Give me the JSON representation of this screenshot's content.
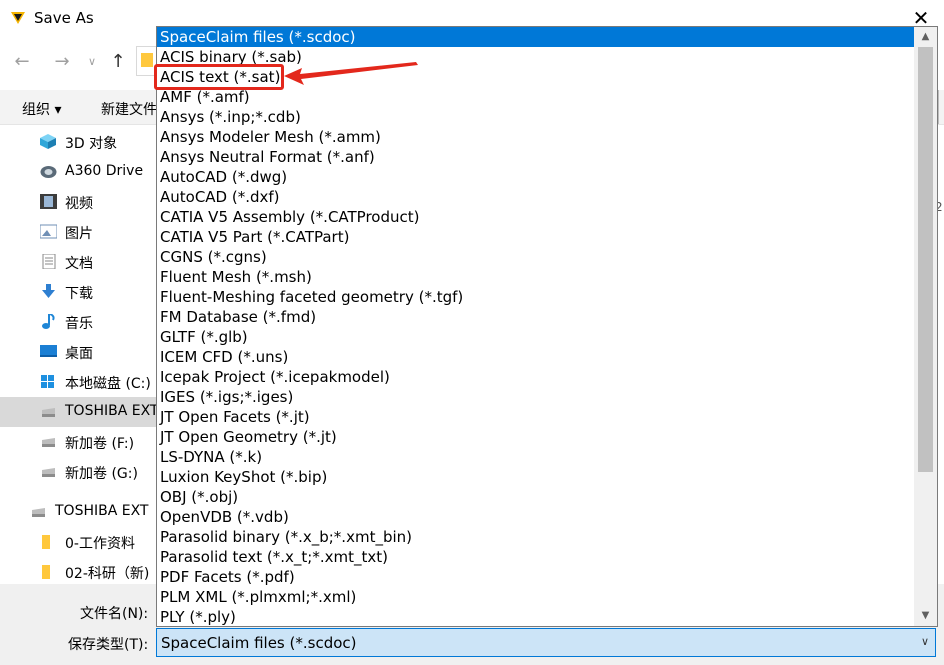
{
  "window": {
    "title": "Save As",
    "close_glyph": "✕",
    "app_icon": "spaceclaim-app-icon"
  },
  "nav": {
    "back_glyph": "←",
    "forward_glyph": "→",
    "recent_glyph": "∨",
    "up_glyph": "↑"
  },
  "toolbar": {
    "organize_label": "组织 ▾",
    "new_folder_label": "新建文件"
  },
  "sidebar": {
    "items": [
      {
        "label": "3D 对象",
        "icon": "3d-objects-icon",
        "color": "#30a7d9"
      },
      {
        "label": "A360 Drive",
        "icon": "a360-drive-icon",
        "color": "#5a6a78"
      },
      {
        "label": "视频",
        "icon": "video-icon",
        "color": "#3c3c3c"
      },
      {
        "label": "图片",
        "icon": "pictures-icon",
        "color": "#6f8fb5"
      },
      {
        "label": "文档",
        "icon": "documents-icon",
        "color": "#8a8a8a"
      },
      {
        "label": "下载",
        "icon": "downloads-icon",
        "color": "#2e7fd1"
      },
      {
        "label": "音乐",
        "icon": "music-icon",
        "color": "#1f86d6"
      },
      {
        "label": "桌面",
        "icon": "desktop-icon",
        "color": "#1b7fd4"
      },
      {
        "label": "本地磁盘 (C:)",
        "icon": "local-disk-icon",
        "color": "#1e90e0"
      },
      {
        "label": "TOSHIBA EXT",
        "icon": "drive-icon",
        "color": "#8c8c8c",
        "selected": true
      },
      {
        "label": "新加卷 (F:)",
        "icon": "drive-icon",
        "color": "#8c8c8c"
      },
      {
        "label": "新加卷 (G:)",
        "icon": "drive-icon",
        "color": "#8c8c8c"
      },
      {
        "label": "TOSHIBA EXT",
        "icon": "drive-icon",
        "color": "#8c8c8c"
      },
      {
        "label": "0-工作资料",
        "icon": "folder-icon",
        "color": "#ffc83d"
      },
      {
        "label": "02-科研（新)",
        "icon": "folder-icon",
        "color": "#ffc83d"
      }
    ]
  },
  "form": {
    "filename_label": "文件名(N):",
    "savetype_label": "保存类型(T):",
    "savetype_value": "SpaceClaim files (*.scdoc)"
  },
  "dropdown": {
    "highlighted_index": 0,
    "items": [
      "SpaceClaim files (*.scdoc)",
      "ACIS binary (*.sab)",
      "ACIS text (*.sat)",
      "AMF (*.amf)",
      "Ansys (*.inp;*.cdb)",
      "Ansys Modeler Mesh (*.amm)",
      "Ansys Neutral Format (*.anf)",
      "AutoCAD (*.dwg)",
      "AutoCAD (*.dxf)",
      "CATIA V5 Assembly (*.CATProduct)",
      "CATIA V5 Part (*.CATPart)",
      "CGNS (*.cgns)",
      "Fluent Mesh (*.msh)",
      "Fluent-Meshing faceted geometry (*.tgf)",
      "FM Database (*.fmd)",
      "GLTF (*.glb)",
      "ICEM CFD (*.uns)",
      "Icepak Project (*.icepakmodel)",
      "IGES (*.igs;*.iges)",
      "JT Open Facets (*.jt)",
      "JT Open Geometry (*.jt)",
      "LS-DYNA (*.k)",
      "Luxion KeyShot (*.bip)",
      "OBJ (*.obj)",
      "OpenVDB (*.vdb)",
      "Parasolid binary (*.x_b;*.xmt_bin)",
      "Parasolid text (*.x_t;*.xmt_txt)",
      "PDF Facets (*.pdf)",
      "PLM XML (*.plmxml;*.xml)",
      "PLY (*.ply)"
    ],
    "scroll_up_glyph": "▲",
    "scroll_down_glyph": "▼"
  },
  "annotation": {
    "color": "#e3281c",
    "highlighted_item": "ACIS text (*.sat)"
  },
  "edge": {
    "digit": "2"
  },
  "colors": {
    "selection_blue": "#0078d7",
    "combo_bg": "#cce4f7",
    "folder": "#ffc83d"
  }
}
